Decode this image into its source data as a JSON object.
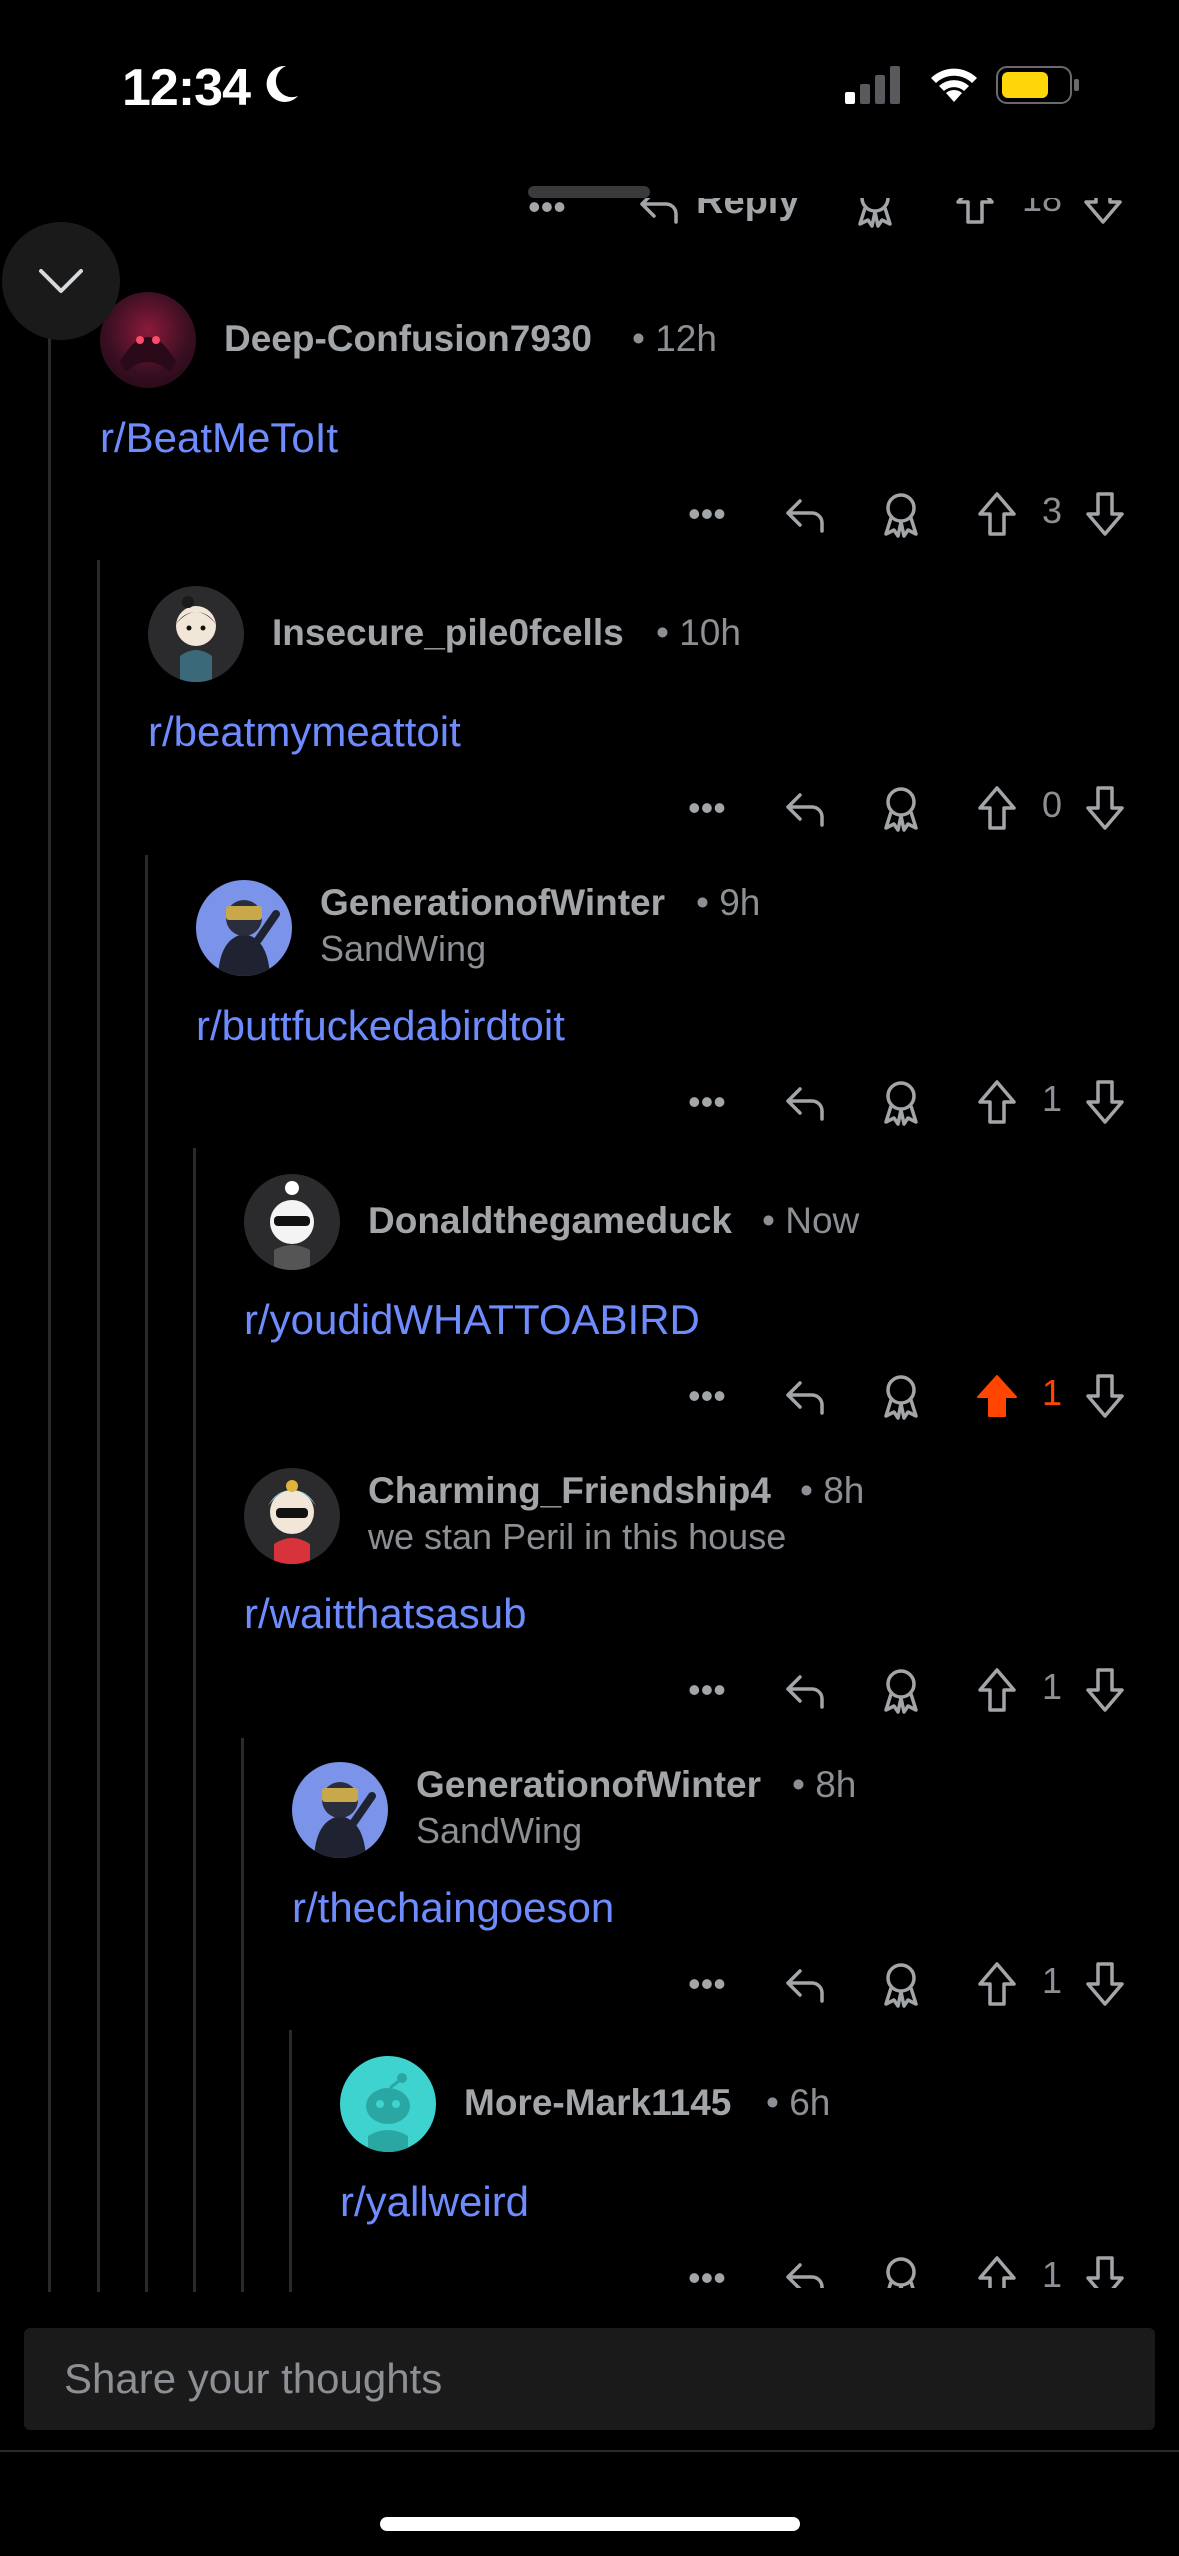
{
  "status_bar": {
    "time": "12:34"
  },
  "previous_comment": {
    "reply_label": "Reply",
    "score": "18"
  },
  "comments": [
    {
      "username": "Deep-Confusion7930",
      "age": "12h",
      "flair": "",
      "body": "r/BeatMeToIt",
      "score": "3",
      "upvoted": false
    },
    {
      "username": "Insecure_pile0fcells",
      "age": "10h",
      "flair": "",
      "body": "r/beatmymeattoit",
      "score": "0",
      "upvoted": false
    },
    {
      "username": "GenerationofWinter",
      "age": "9h",
      "flair": "SandWing",
      "body": "r/buttfuckedabirdtoit",
      "score": "1",
      "upvoted": false
    },
    {
      "username": "Donaldthegameduck",
      "age": "Now",
      "flair": "",
      "body": "r/youdidWHATTOABIRD",
      "score": "1",
      "upvoted": true
    },
    {
      "username": "Charming_Friendship4",
      "age": "8h",
      "flair": "we stan Peril in this house",
      "body": "r/waitthatsasub",
      "score": "1",
      "upvoted": false
    },
    {
      "username": "GenerationofWinter",
      "age": "8h",
      "flair": "SandWing",
      "body": "r/thechaingoeson",
      "score": "1",
      "upvoted": false
    },
    {
      "username": "More-Mark1145",
      "age": "6h",
      "flair": "",
      "body": "r/yallweird",
      "score": "1",
      "upvoted": false
    }
  ],
  "composer": {
    "placeholder": "Share your thoughts"
  },
  "colors": {
    "background": "#000000",
    "link": "#6f8cff",
    "upvote": "#ff4500",
    "muted": "#8c8f93"
  }
}
